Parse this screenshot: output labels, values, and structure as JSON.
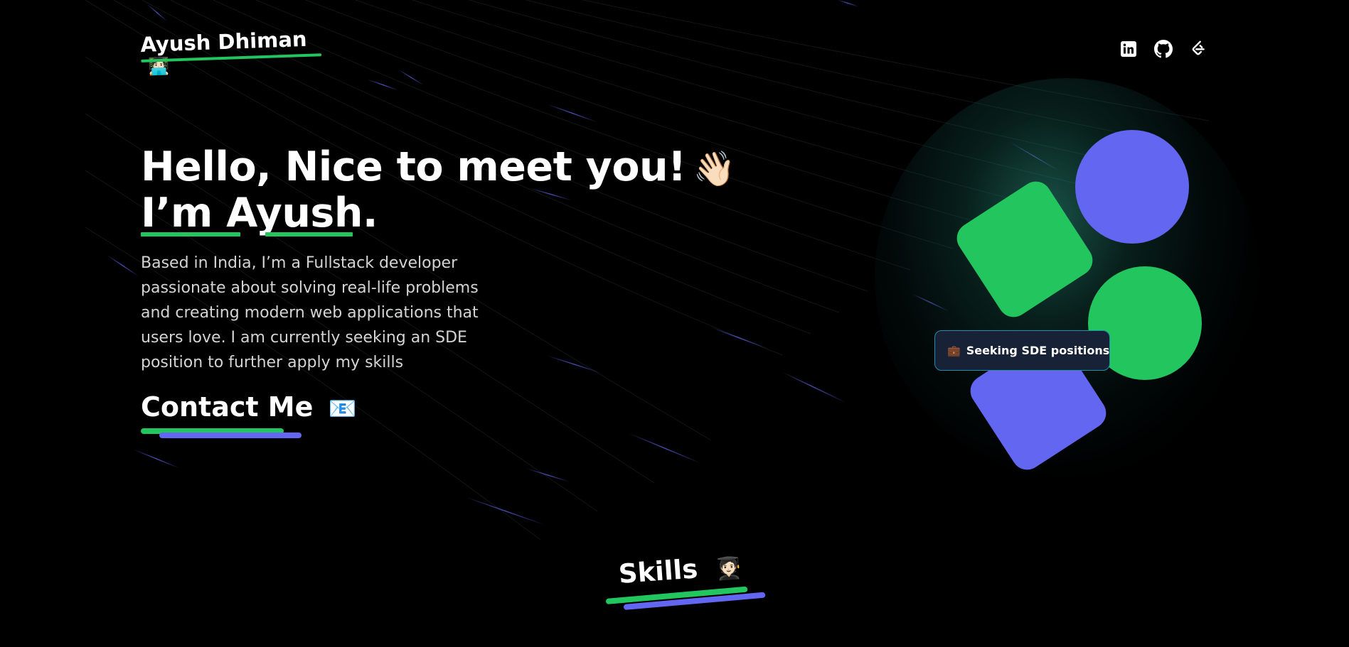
{
  "header": {
    "logo_text": "Ayush Dhiman",
    "logo_emoji": "🧑🏻‍💻",
    "social_links": [
      {
        "icon": "linkedin-icon",
        "label": "LinkedIn"
      },
      {
        "icon": "github-icon",
        "label": "GitHub"
      },
      {
        "icon": "leetcode-icon",
        "label": "LeetCode"
      }
    ]
  },
  "hero": {
    "greeting": "Hello, Nice to meet you!",
    "wave_emoji": "👋🏻",
    "intro": "I’m Ayush.",
    "bio": "Based in India, I’m a Fullstack developer passionate about solving real-life problems and creating modern web applications that users love. I am currently seeking an SDE position to further apply my skills",
    "contact_label": "Contact Me",
    "contact_emoji": "📧"
  },
  "badge": {
    "icon": "💼",
    "text": "Seeking SDE positions"
  },
  "skills": {
    "title": "Skills",
    "emoji": "🧑🏻‍🎓"
  },
  "colors": {
    "accent_green": "#22c55e",
    "accent_indigo": "#6366f1",
    "background": "#000000",
    "badge_bg": "#172236",
    "badge_border": "#1f8fb0"
  }
}
